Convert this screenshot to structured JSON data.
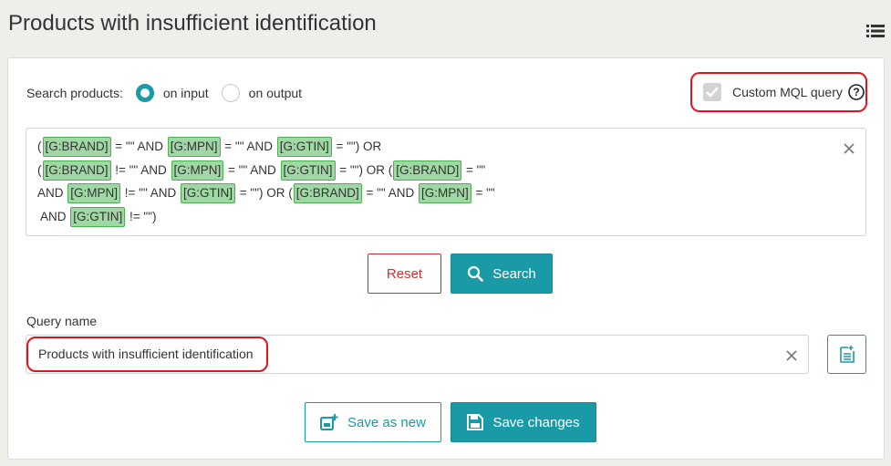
{
  "header": {
    "title": "Products with insufficient identification",
    "menu_icon": "list-icon"
  },
  "search": {
    "label": "Search products:",
    "options": [
      {
        "label": "on input",
        "checked": true
      },
      {
        "label": "on output",
        "checked": false
      }
    ],
    "custom_mql": {
      "label": "Custom MQL query",
      "checked": true,
      "help_icon": "question-circle-icon"
    }
  },
  "query": {
    "line1": {
      "p0": "(",
      "t0": "[G:BRAND]",
      "p1": " = \"\" AND ",
      "t1": "[G:MPN]",
      "p2": " = \"\" AND ",
      "t2": "[G:GTIN]",
      "p3": " = \"\") OR"
    },
    "line2": {
      "p0": "(",
      "t0": "[G:BRAND]",
      "p1": " != \"\" AND ",
      "t1": "[G:MPN]",
      "p2": " = \"\" AND ",
      "t2": "[G:GTIN]",
      "p3": " = \"\") OR (",
      "t3": "[G:BRAND]",
      "p4": " = \"\""
    },
    "line3": {
      "p0": "AND ",
      "t0": "[G:MPN]",
      "p1": " != \"\" AND ",
      "t1": "[G:GTIN]",
      "p2": " = \"\") OR (",
      "t2": "[G:BRAND]",
      "p3": " = \"\" AND ",
      "t3": "[G:MPN]",
      "p4": " = \"\""
    },
    "line4": {
      "p0": " AND ",
      "t0": "[G:GTIN]",
      "p1": " != \"\")"
    }
  },
  "actions": {
    "reset_label": "Reset",
    "search_label": "Search"
  },
  "query_name": {
    "label": "Query name",
    "value": "Products with insufficient identification"
  },
  "save": {
    "save_new_label": "Save as new",
    "save_changes_label": "Save changes"
  },
  "colors": {
    "accent": "#1a9aa6",
    "danger": "#c4332f",
    "highlight": "#e0141e",
    "tag_bg": "#9fd8a4",
    "tag_border": "#4caf50"
  }
}
